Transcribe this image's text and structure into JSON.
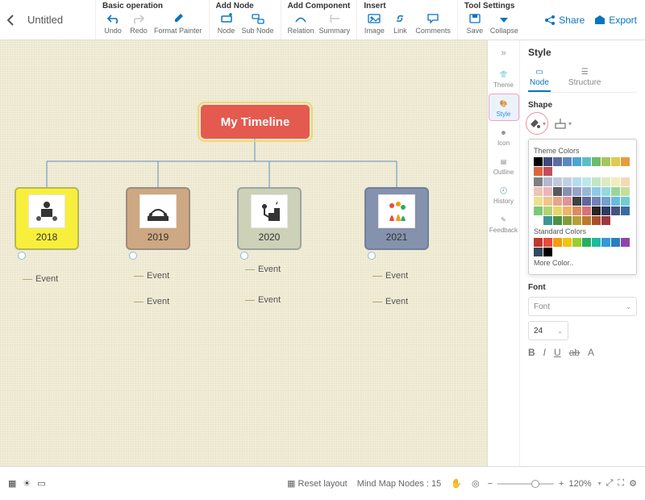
{
  "doc_title": "Untitled",
  "toolbar": {
    "groups": {
      "basic": {
        "header": "Basic operation",
        "undo": "Undo",
        "redo": "Redo",
        "format_painter": "Format Painter"
      },
      "add_node": {
        "header": "Add Node",
        "node": "Node",
        "sub_node": "Sub Node"
      },
      "add_component": {
        "header": "Add Component",
        "relation": "Relation",
        "summary": "Summary"
      },
      "insert": {
        "header": "Insert",
        "image": "Image",
        "link": "Link",
        "comments": "Comments"
      },
      "tool_settings": {
        "header": "Tool Settings",
        "save": "Save",
        "collapse": "Collapse"
      }
    },
    "share": "Share",
    "export": "Export"
  },
  "canvas": {
    "root_title": "My Timeline",
    "years": [
      {
        "label": "2018",
        "events": [
          "Event"
        ]
      },
      {
        "label": "2019",
        "events": [
          "Event",
          "Event"
        ]
      },
      {
        "label": "2020",
        "events": [
          "Event",
          "Event"
        ]
      },
      {
        "label": "2021",
        "events": [
          "Event",
          "Event"
        ]
      }
    ]
  },
  "side_rail": {
    "theme": "Theme",
    "style": "Style",
    "icon": "Icon",
    "outline": "Outline",
    "history": "History",
    "feedback": "Feedback"
  },
  "panel": {
    "title": "Style",
    "tab_node": "Node",
    "tab_structure": "Structure",
    "shape_label": "Shape",
    "theme_colors_label": "Theme Colors",
    "standard_colors_label": "Standard Colors",
    "more_color": "More Color..",
    "font_label": "Font",
    "font_placeholder": "Font",
    "font_size": "24",
    "style_b": "B",
    "style_i": "I",
    "style_u": "U",
    "style_ab": "ab",
    "style_a": "A"
  },
  "statusbar": {
    "reset_layout": "Reset layout",
    "nodes_label": "Mind Map Nodes :",
    "nodes_count": "15",
    "zoom": "120%"
  },
  "colors": {
    "theme": [
      "#000000",
      "#3f4a7a",
      "#5b6ca0",
      "#5c87c0",
      "#4aa5d4",
      "#59c0c6",
      "#6dbb6a",
      "#a5c65b",
      "#e2c94f",
      "#e79c3e",
      "#d9673d",
      "#c44d58"
    ],
    "theme_tints": [
      "#7f7f7f",
      "#b3b8cf",
      "#c0c8de",
      "#bfd0e6",
      "#b6dbee",
      "#bee7e9",
      "#c3e5c2",
      "#dcebc0",
      "#f3ebbc",
      "#f5d8b4",
      "#efc4b2",
      "#e9b7ba",
      "#595959",
      "#8790b4",
      "#98a3c9",
      "#98b6d9",
      "#8ecae4",
      "#97d8db",
      "#9cd59b",
      "#c5de9a",
      "#ece08f",
      "#f0c58a",
      "#e6a687",
      "#e09398",
      "#404040",
      "#5d6896",
      "#7481b4",
      "#72a0cf",
      "#6bbbdc",
      "#74cbd0",
      "#7bc87a",
      "#b1d377",
      "#e6d66b",
      "#ecb665",
      "#de8c61",
      "#d77477",
      "#262626",
      "#313a62",
      "#46527f",
      "#3d6aa1",
      "#357f a7",
      "#3e9598",
      "#4a9149",
      "#809c3f",
      "#b5a135",
      "#bb7b2c",
      "#ab4f2b",
      "#9e383e"
    ],
    "standard": [
      "#c0392b",
      "#e74c3c",
      "#f39c12",
      "#f1c40f",
      "#9acd32",
      "#27ae60",
      "#1abc9c",
      "#3498db",
      "#2980b9",
      "#8e44ad",
      "#34495e",
      "#000000"
    ]
  }
}
